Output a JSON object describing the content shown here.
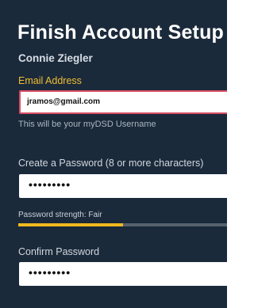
{
  "page": {
    "title": "Finish Account Setup",
    "user_name": "Connie Ziegler"
  },
  "email": {
    "label": "Email Address",
    "value": "jramos@gmail.com",
    "hint": "This will be your myDSD Username"
  },
  "password": {
    "label": "Create a Password (8 or more characters)",
    "masked_value": "•••••••••",
    "strength_label": "Password strength: Fair",
    "strength_level": 0.5
  },
  "confirm_password": {
    "label": "Confirm Password",
    "masked_value": "•••••••••"
  },
  "colors": {
    "background": "#1b2a3a",
    "accent": "#f1be33",
    "error_border": "#d94d63",
    "strength_track": "#56616d",
    "strength_fill": "#f0b91e"
  }
}
